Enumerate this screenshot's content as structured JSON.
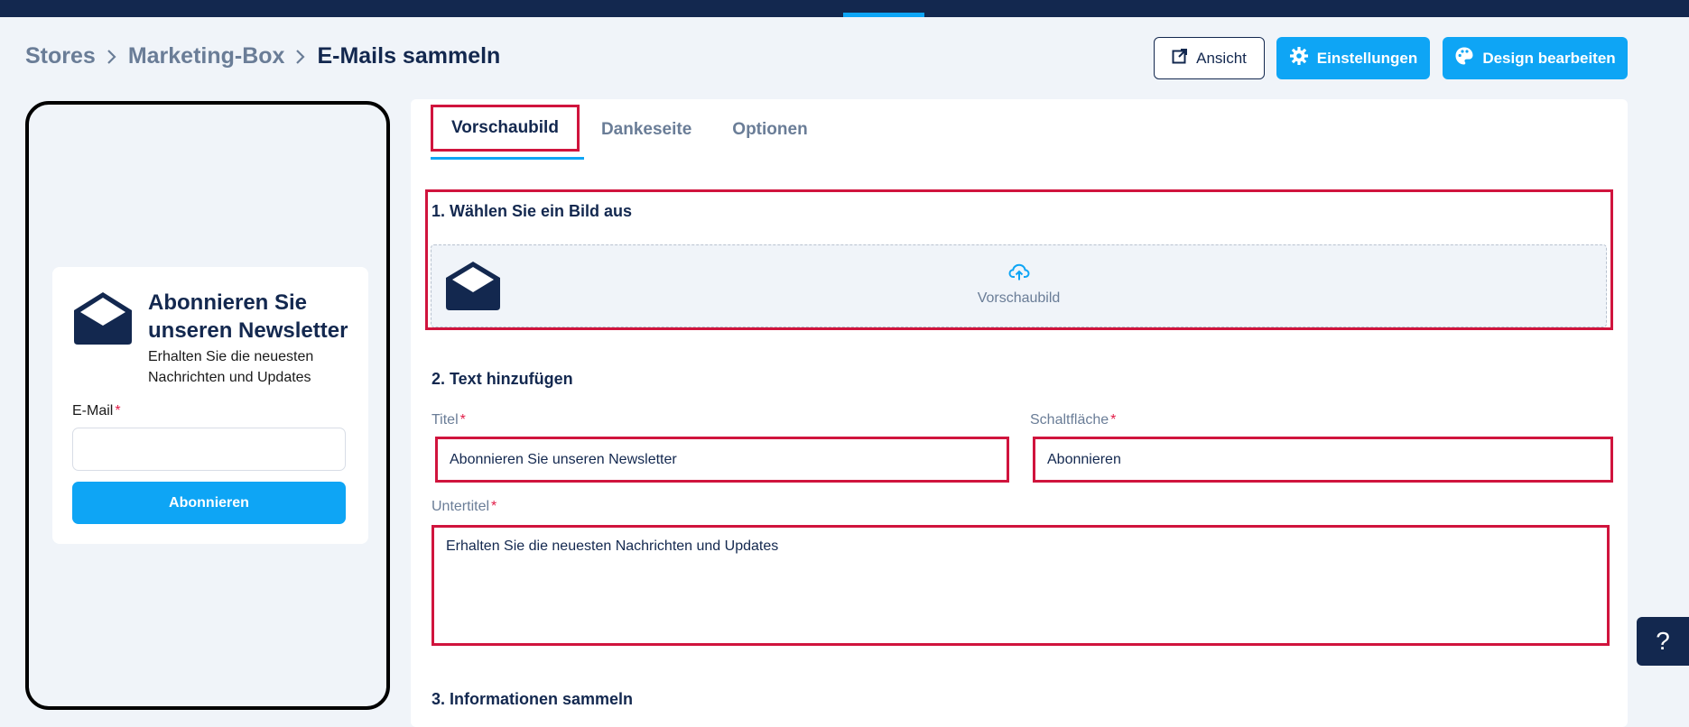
{
  "breadcrumb": {
    "items": [
      "Stores",
      "Marketing-Box",
      "E-Mails sammeln"
    ]
  },
  "header": {
    "view_label": "Ansicht",
    "settings_label": "Einstellungen",
    "design_label": "Design bearbeiten"
  },
  "preview": {
    "title": "Abonnieren Sie unseren Newsletter",
    "subtitle": "Erhalten Sie die neuesten Nachrichten und Updates",
    "email_label": "E-Mail",
    "required_mark": "*",
    "submit_label": "Abonnieren"
  },
  "tabs": [
    "Vorschaubild",
    "Dankeseite",
    "Optionen"
  ],
  "sections": {
    "image": {
      "title": "1. Wählen Sie ein Bild aus",
      "upload_label": "Vorschaubild"
    },
    "text": {
      "title": "2. Text hinzufügen",
      "title_label": "Titel",
      "title_value": "Abonnieren Sie unseren Newsletter",
      "button_label": "Schaltfläche",
      "button_value": "Abonnieren",
      "subtitle_label": "Untertitel",
      "subtitle_value": "Erhalten Sie die neuesten Nachrichten und Updates"
    },
    "collect": {
      "title": "3. Informationen sammeln"
    }
  },
  "help": {
    "label": "?"
  },
  "colors": {
    "navy": "#13284f",
    "accent": "#0ea5f5",
    "highlight": "#d0143d"
  }
}
